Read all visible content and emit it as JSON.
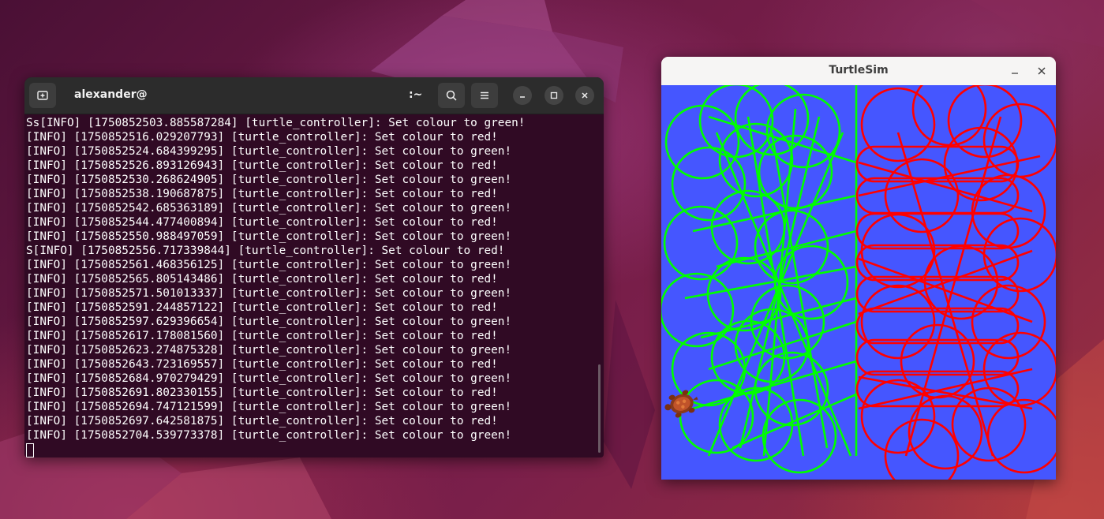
{
  "terminal": {
    "title": "alexander@",
    "path": ":~",
    "log_lines": [
      "Ss[INFO] [1750852503.885587284] [turtle_controller]: Set colour to green!",
      "[INFO] [1750852516.029207793] [turtle_controller]: Set colour to red!",
      "[INFO] [1750852524.684399295] [turtle_controller]: Set colour to green!",
      "[INFO] [1750852526.893126943] [turtle_controller]: Set colour to red!",
      "[INFO] [1750852530.268624905] [turtle_controller]: Set colour to green!",
      "[INFO] [1750852538.190687875] [turtle_controller]: Set colour to red!",
      "[INFO] [1750852542.685363189] [turtle_controller]: Set colour to green!",
      "[INFO] [1750852544.477400894] [turtle_controller]: Set colour to red!",
      "[INFO] [1750852550.988497059] [turtle_controller]: Set colour to green!",
      "S[INFO] [1750852556.717339844] [turtle_controller]: Set colour to red!",
      "[INFO] [1750852561.468356125] [turtle_controller]: Set colour to green!",
      "[INFO] [1750852565.805143486] [turtle_controller]: Set colour to red!",
      "[INFO] [1750852571.501013337] [turtle_controller]: Set colour to green!",
      "[INFO] [1750852591.244857122] [turtle_controller]: Set colour to red!",
      "[INFO] [1750852597.629396654] [turtle_controller]: Set colour to green!",
      "[INFO] [1750852617.178081560] [turtle_controller]: Set colour to red!",
      "[INFO] [1750852623.274875328] [turtle_controller]: Set colour to green!",
      "[INFO] [1750852643.723169557] [turtle_controller]: Set colour to red!",
      "[INFO] [1750852684.970279429] [turtle_controller]: Set colour to green!",
      "[INFO] [1750852691.802330155] [turtle_controller]: Set colour to red!",
      "[INFO] [1750852694.747121599] [turtle_controller]: Set colour to green!",
      "[INFO] [1750852697.642581875] [turtle_controller]: Set colour to red!",
      "[INFO] [1750852704.539773378] [turtle_controller]: Set colour to green!"
    ],
    "icons": {
      "new_tab": "new-tab-icon",
      "search": "search-icon",
      "menu": "hamburger-menu-icon",
      "minimize": "minimize-icon",
      "maximize": "maximize-icon",
      "close": "close-icon"
    },
    "colors": {
      "background": "#300a24",
      "header": "#2c2c2c",
      "text": "#ffffff"
    }
  },
  "turtlesim": {
    "title": "TurtleSim",
    "icons": {
      "minimize": "minimize-icon",
      "close": "close-icon",
      "turtle": "turtle-icon"
    },
    "colors": {
      "background": "#4556ff",
      "left_pen": "#00ff00",
      "right_pen": "#ff0000"
    }
  }
}
